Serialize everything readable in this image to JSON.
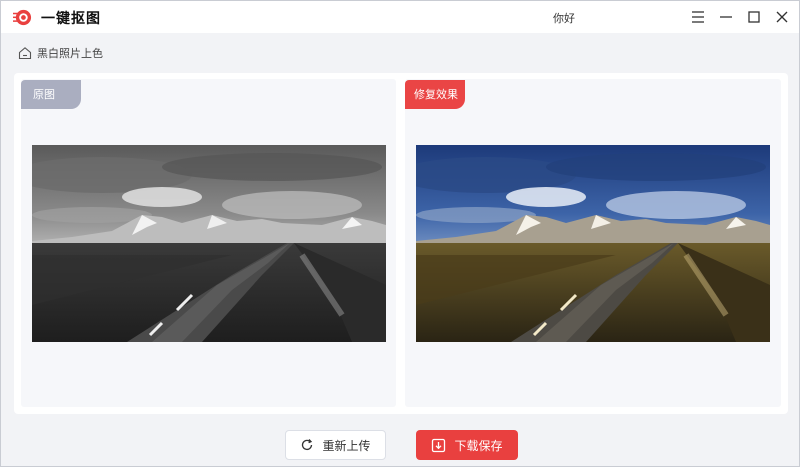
{
  "app": {
    "title": "一键抠图",
    "user": "你好"
  },
  "titlebar_icons": [
    "menu-icon",
    "minimize-icon",
    "maximize-icon",
    "close-icon"
  ],
  "breadcrumb": {
    "icon": "home-icon",
    "label": "黑白照片上色"
  },
  "panels": {
    "original": {
      "tag": "原图",
      "image_desc_icon": "grayscale-landscape-photo"
    },
    "result": {
      "tag": "修复效果",
      "image_desc_icon": "colorized-landscape-photo"
    }
  },
  "actions": {
    "reupload": {
      "label": "重新上传",
      "icon": "refresh-icon"
    },
    "download": {
      "label": "下载保存",
      "icon": "download-icon"
    }
  },
  "colors": {
    "accent": "#e9403f",
    "tag_gray": "#aaaec0",
    "background": "#f2f3f6"
  }
}
